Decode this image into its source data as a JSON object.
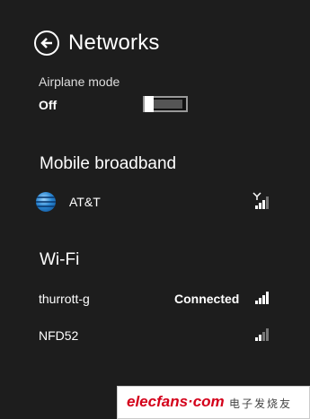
{
  "header": {
    "title": "Networks"
  },
  "airplane": {
    "label": "Airplane mode",
    "state": "Off"
  },
  "mobile": {
    "section_title": "Mobile broadband",
    "carrier": "AT&T",
    "signal_level": 3,
    "signal_max": 4
  },
  "wifi": {
    "section_title": "Wi-Fi",
    "networks": [
      {
        "name": "thurrott-g",
        "status": "Connected",
        "signal_level": 4,
        "signal_max": 4
      },
      {
        "name": "NFD52",
        "status": "",
        "signal_level": 2,
        "signal_max": 4
      }
    ]
  },
  "watermark": {
    "text": "elecfans·com",
    "cn": "电子发烧友"
  },
  "colors": {
    "background": "#1d1d1d",
    "text": "#ffffff",
    "watermark_red": "#d4001a"
  }
}
